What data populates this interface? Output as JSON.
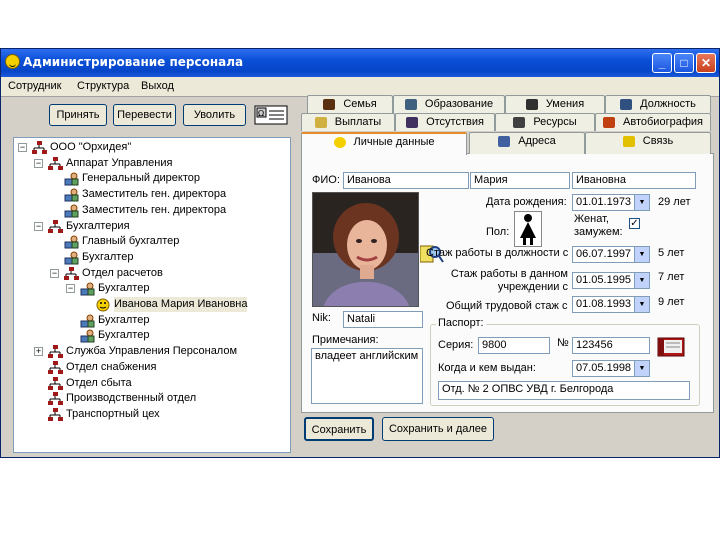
{
  "window": {
    "title": "Администрирование персонала"
  },
  "menu": [
    "Сотрудник",
    "Структура",
    "Выход"
  ],
  "toolbar": {
    "accept": "Принять",
    "transfer": "Перевести",
    "dismiss": "Уволить"
  },
  "tree": [
    {
      "label": "ООО \"Орхидея\"",
      "level": 0,
      "expander": "minus"
    },
    {
      "label": "Аппарат Управления",
      "level": 1,
      "expander": "minus"
    },
    {
      "label": "Генеральный директор",
      "level": 2,
      "expander": ""
    },
    {
      "label": "Заместитель ген. директора",
      "level": 2,
      "expander": ""
    },
    {
      "label": "Заместитель ген. директора",
      "level": 2,
      "expander": ""
    },
    {
      "label": "Бухгалтерия",
      "level": 1,
      "expander": "minus"
    },
    {
      "label": "Главный бухгалтер",
      "level": 2,
      "expander": ""
    },
    {
      "label": "Бухгалтер",
      "level": 2,
      "expander": ""
    },
    {
      "label": "Отдел расчетов",
      "level": 2,
      "expander": "minus"
    },
    {
      "label": "Бухгалтер",
      "level": 3,
      "expander": "minus"
    },
    {
      "label": "Иванова Мария Ивановна",
      "level": 4,
      "expander": "",
      "selected": true
    },
    {
      "label": "Бухгалтер",
      "level": 3,
      "expander": ""
    },
    {
      "label": "Бухгалтер",
      "level": 3,
      "expander": ""
    },
    {
      "label": "Служба Управления Персоналом",
      "level": 1,
      "expander": "plus"
    },
    {
      "label": "Отдел снабжения",
      "level": 1,
      "expander": ""
    },
    {
      "label": "Отдел сбыта",
      "level": 1,
      "expander": ""
    },
    {
      "label": "Производственный отдел",
      "level": 1,
      "expander": ""
    },
    {
      "label": "Транспортный цех",
      "level": 1,
      "expander": ""
    }
  ],
  "tabs": {
    "row1": [
      "Семья",
      "Образование",
      "Умения",
      "Должность"
    ],
    "row2": [
      "Выплаты",
      "Отсутствия",
      "Ресурсы",
      "Автобиография"
    ],
    "row3": [
      "Личные данные",
      "Адреса",
      "Связь"
    ]
  },
  "personal": {
    "fio_label": "ФИО:",
    "last_name": "Иванова",
    "first_name": "Мария",
    "middle_name": "Ивановна",
    "birth_label": "Дата рождения:",
    "birth_date": "01.01.1973",
    "age": "29 лет",
    "sex_label": "Пол:",
    "married_label": "Женат, замужем:",
    "married_check": "✓",
    "pos_exp_label": "Стаж работы в должности с",
    "pos_exp_date": "06.07.1997",
    "pos_exp_years": "5 лет",
    "inst_exp_label": "Стаж работы в данном учреждении с",
    "inst_exp_date": "01.05.1995",
    "inst_exp_years": "7 лет",
    "total_exp_label": "Общий трудовой стаж с",
    "total_exp_date": "01.08.1993",
    "total_exp_years": "9 лет",
    "nik_label": "Nik:",
    "nik": "Natali",
    "notes_label": "Примечания:",
    "notes": "владеет английским",
    "passport_group": "Паспорт:",
    "series_label": "Серия:",
    "series": "9800",
    "number_label": "№",
    "number": "123456",
    "issued_label": "Когда и кем выдан:",
    "issued_date": "07.05.1998",
    "issued_by": "Отд. № 2 ОПВС УВД г. Белгорода"
  },
  "actions": {
    "save": "Сохранить",
    "save_next": "Сохранить и далее"
  }
}
